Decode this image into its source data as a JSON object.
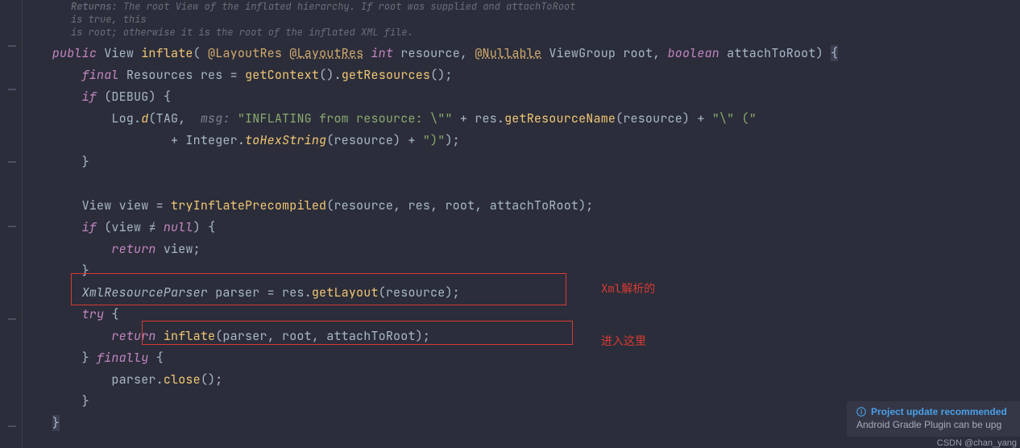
{
  "doc": {
    "line1_a": "Returns: ",
    "line1_b": "The root View of the inflated hierarchy. If root was supplied and attachToRoot is true, this",
    "line2": "is root; otherwise it is the root of the inflated XML file."
  },
  "code": {
    "l1_public": "public",
    "l1_view": "View",
    "l1_inflate": "inflate",
    "l1_at": "@",
    "l1_layoutres": "LayoutRes",
    "l1_int": "int",
    "l1_resource": "resource",
    "l1_nullable": "Nullable",
    "l1_viewgroup": "ViewGroup",
    "l1_root": "root",
    "l1_boolean": "boolean",
    "l1_attach": "attachToRoot",
    "l2_final": "final",
    "l2_resources": "Resources",
    "l2_res": "res",
    "l2_eq": " = ",
    "l2_getContext": "getContext",
    "l2_getResources": "getResources",
    "l3_if": "if",
    "l3_debug": "DEBUG",
    "l4_log": "Log",
    "l4_d": "d",
    "l4_tag": "TAG",
    "l4_msg": "msg:",
    "l4_s1": "\"INFLATING from resource: \\\"\"",
    "l4_res": "res",
    "l4_grm": "getResourceName",
    "l4_rsc": "resource",
    "l4_s2": "\"\\\" (\"",
    "l5_plus": "+",
    "l5_integer": "Integer",
    "l5_tohex": "toHexString",
    "l5_rsc": "resource",
    "l5_s": "\")\"",
    "l9_view": "View",
    "l9_v": "view",
    "l9_eq": " = ",
    "l9_try": "tryInflatePrecompiled",
    "l9_rsc": "resource",
    "l9_res": "res",
    "l9_root": "root",
    "l9_attach": "attachToRoot",
    "l10_if": "if",
    "l10_view": "view",
    "l10_ne": "≠",
    "l10_null": "null",
    "l11_return": "return",
    "l11_view": "view",
    "l13_xrp": "XmlResourceParser",
    "l13_parser": "parser",
    "l13_eq": " = ",
    "l13_res": "res",
    "l13_getlayout": "getLayout",
    "l13_rsc": "resource",
    "l14_try": "try",
    "l15_return": "return",
    "l15_inflate": "inflate",
    "l15_parser": "parser",
    "l15_root": "root",
    "l15_attach": "attachToRoot",
    "l16_finally": "finally",
    "l17_parser": "parser",
    "l17_close": "close"
  },
  "annotation": {
    "a1": "Xml解析的",
    "a2": "进入这里"
  },
  "notification": {
    "title": "Project update recommended",
    "message": "Android Gradle Plugin can be upg"
  },
  "watermark": "CSDN @chan_yang"
}
